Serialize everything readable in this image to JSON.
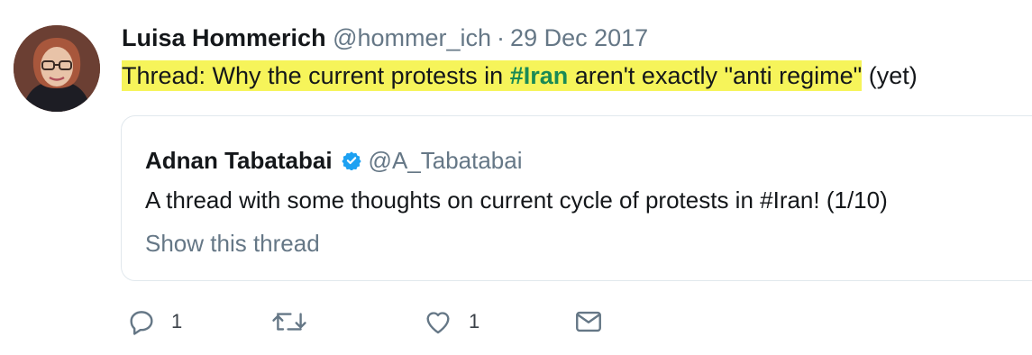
{
  "author": {
    "name": "Luisa Hommerich",
    "handle": "@hommer_ich",
    "separator": "·",
    "date": "29 Dec 2017"
  },
  "tweet": {
    "text_before": "Thread: Why the current protests in ",
    "hashtag": "#Iran",
    "text_after_highlighted": " aren't exactly \"anti regime\"",
    "text_tail": " (yet)",
    "highlight_color": "#f6f45a",
    "hashtag_color": "#1a8a55"
  },
  "quote": {
    "name": "Adnan Tabatabai",
    "verified_icon": "verified-badge-icon",
    "handle": "@A_Tabatabai",
    "text": "A thread with some thoughts on current cycle of protests in #Iran! (1/10)",
    "show_thread": "Show this thread"
  },
  "actions": {
    "reply_count": "1",
    "retweet_count": "",
    "like_count": "1",
    "icons": [
      "reply-icon",
      "retweet-icon",
      "like-icon",
      "message-icon"
    ]
  },
  "colors": {
    "secondary_text": "#657786",
    "verified": "#1da1f2",
    "border": "#e1e8ed"
  }
}
